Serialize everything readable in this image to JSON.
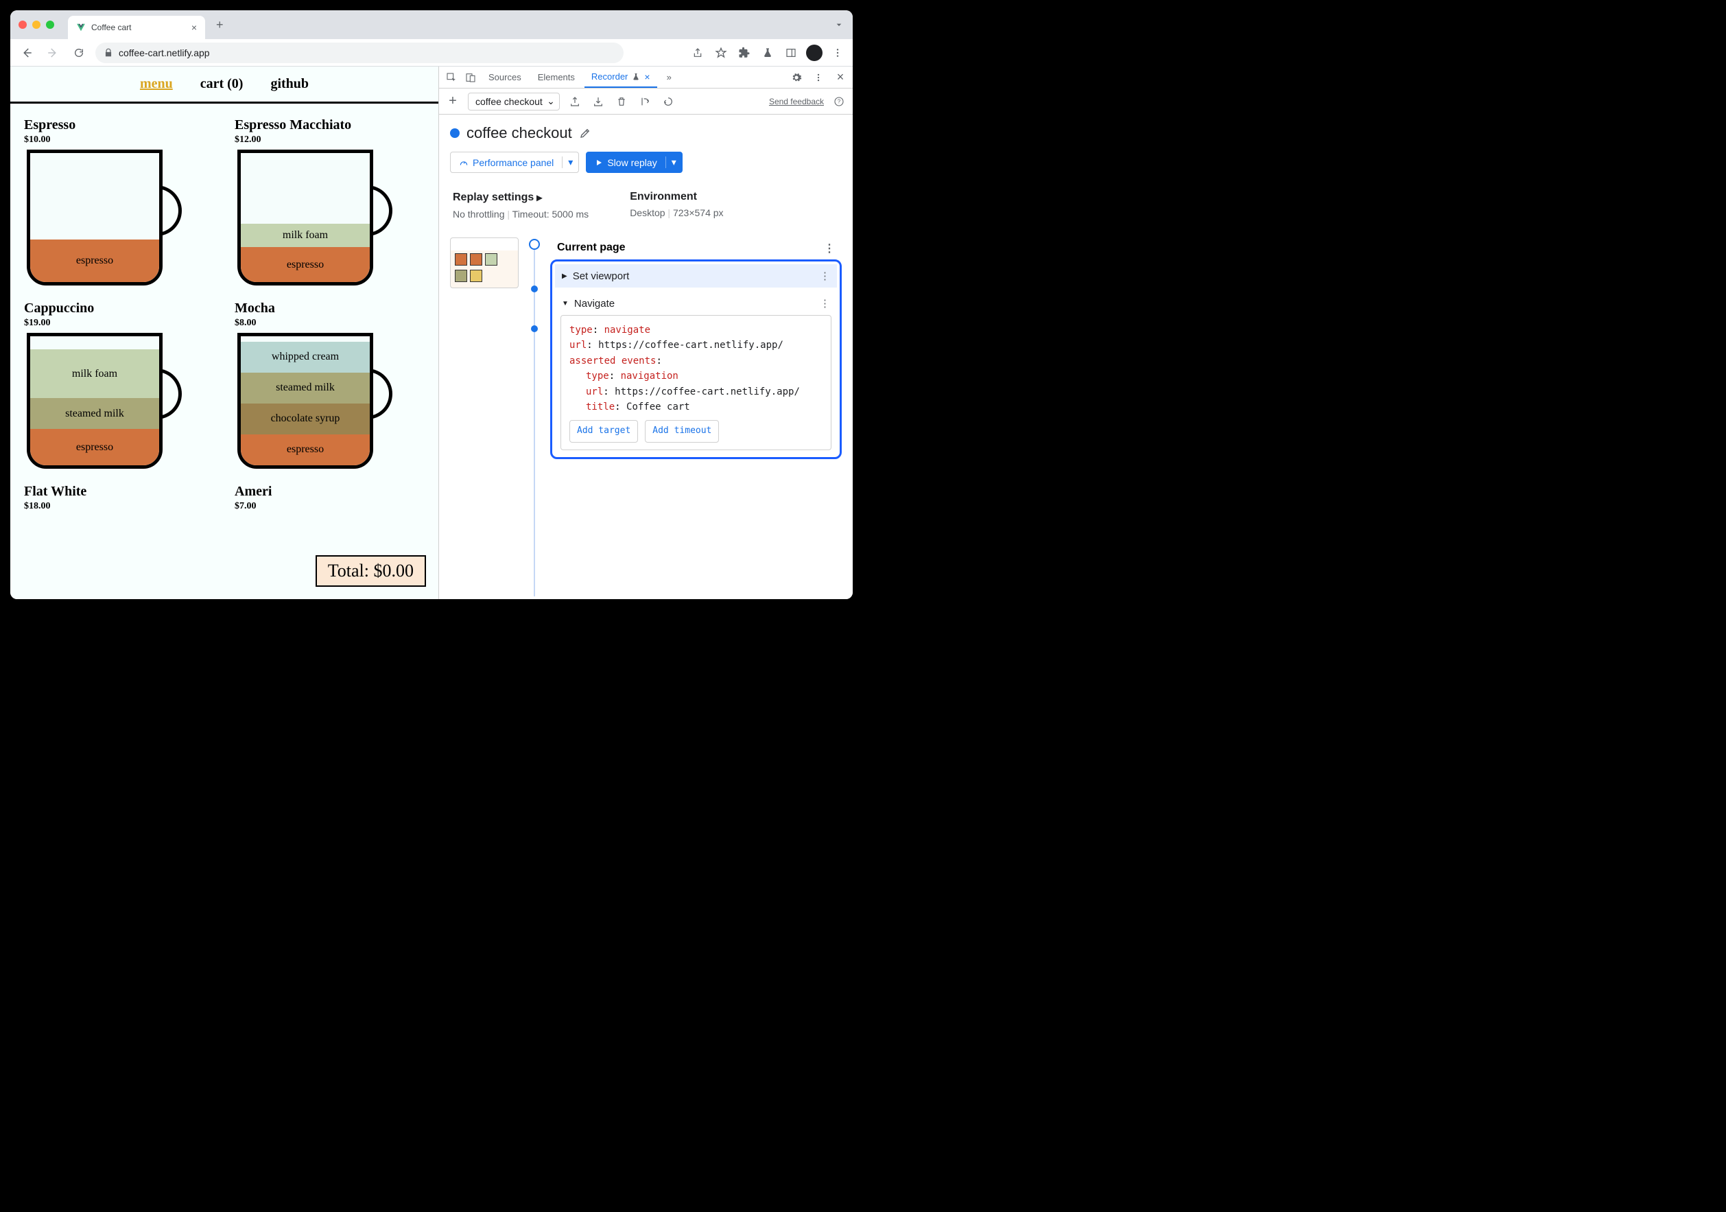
{
  "browser": {
    "tab_title": "Coffee cart",
    "url": "coffee-cart.netlify.app"
  },
  "page": {
    "nav": {
      "menu": "menu",
      "cart": "cart (0)",
      "github": "github"
    },
    "products": [
      {
        "name": "Espresso",
        "price": "$10.00"
      },
      {
        "name": "Espresso Macchiato",
        "price": "$12.00"
      },
      {
        "name": "Cappuccino",
        "price": "$19.00"
      },
      {
        "name": "Mocha",
        "price": "$8.00"
      },
      {
        "name": "Flat White",
        "price": "$18.00"
      },
      {
        "name": "Ameri",
        "price": "$7.00"
      }
    ],
    "layers": {
      "espresso": "espresso",
      "milk_foam": "milk foam",
      "steamed_milk": "steamed milk",
      "whipped_cream": "whipped cream",
      "chocolate_syrup": "chocolate syrup"
    },
    "total": "Total: $0.00"
  },
  "devtools": {
    "tabs": {
      "sources": "Sources",
      "elements": "Elements",
      "recorder": "Recorder"
    },
    "recording_name": "coffee checkout",
    "feedback": "Send feedback",
    "title": "coffee checkout",
    "perf_btn": "Performance panel",
    "replay_btn": "Slow replay",
    "replay_settings_label": "Replay settings",
    "throttling": "No throttling",
    "timeout": "Timeout: 5000 ms",
    "environment_label": "Environment",
    "env_device": "Desktop",
    "env_size": "723×574 px",
    "current_page": "Current page",
    "steps": {
      "set_viewport": "Set viewport",
      "navigate": "Navigate",
      "detail": {
        "type_k": "type",
        "type_v": "navigate",
        "url_k": "url",
        "url_v": "https://coffee-cart.netlify.app/",
        "asserted_k": "asserted events",
        "nav_type_v": "navigation",
        "nav_url_v": "https://coffee-cart.netlify.app/",
        "title_k": "title",
        "title_v": "Coffee cart"
      },
      "add_target": "Add target",
      "add_timeout": "Add timeout"
    }
  }
}
